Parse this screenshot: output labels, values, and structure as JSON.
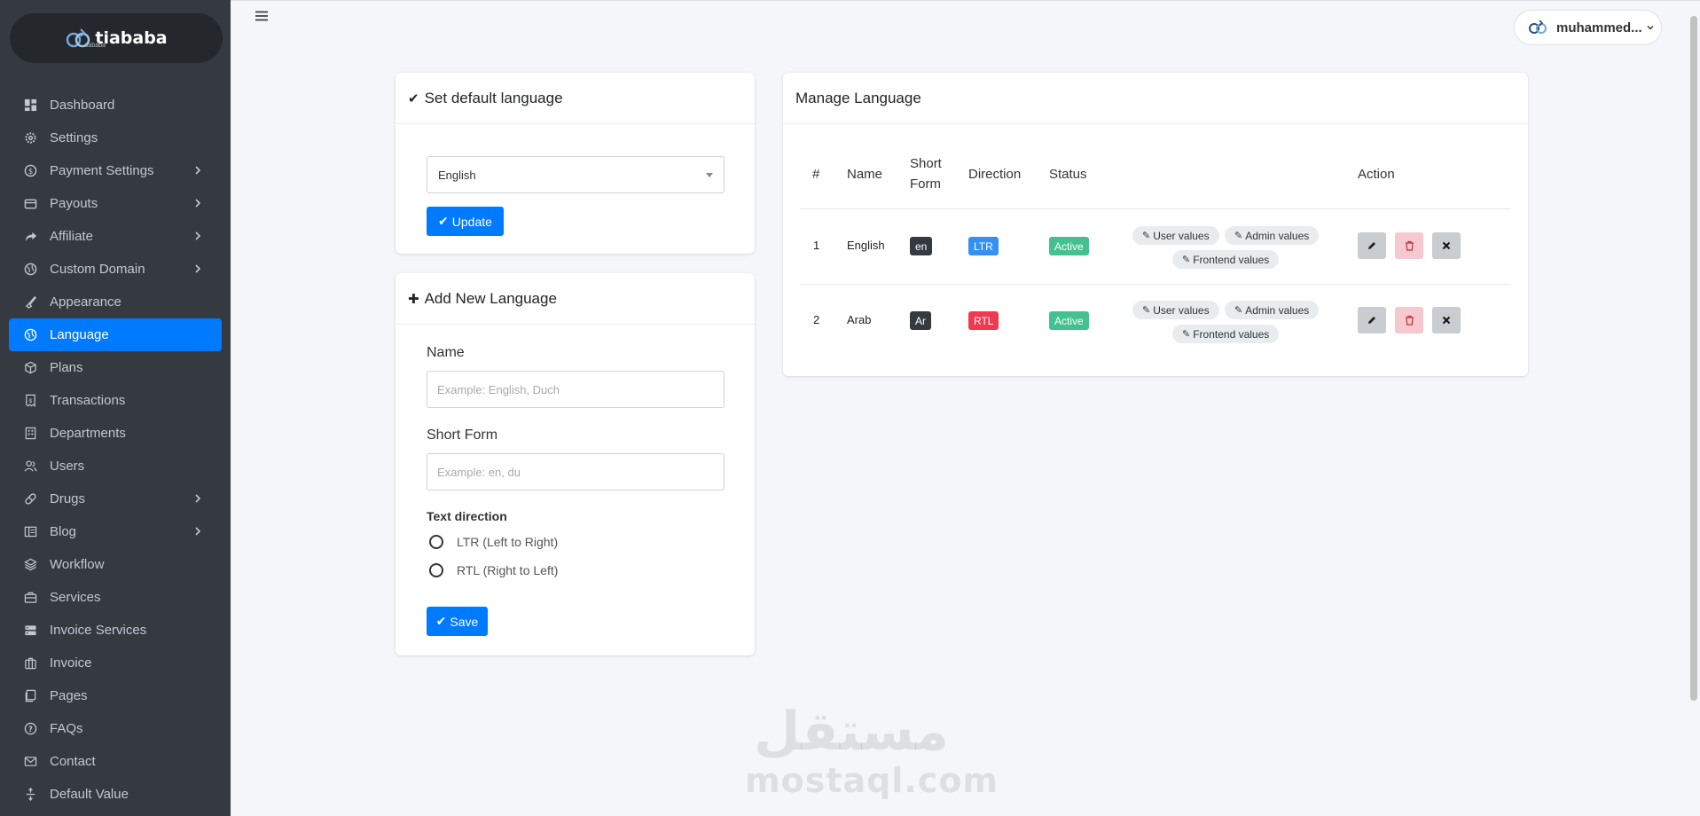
{
  "brand": {
    "name": "tiababa",
    "sub": "tiababa"
  },
  "sidebar": {
    "items": [
      {
        "label": "Dashboard",
        "icon": "dashboard-icon",
        "arrow": false
      },
      {
        "label": "Settings",
        "icon": "gear-icon",
        "arrow": false
      },
      {
        "label": "Payment Settings",
        "icon": "dollar-icon",
        "arrow": true
      },
      {
        "label": "Payouts",
        "icon": "wallet-icon",
        "arrow": true
      },
      {
        "label": "Affiliate",
        "icon": "share-icon",
        "arrow": true
      },
      {
        "label": "Custom Domain",
        "icon": "globe-icon",
        "arrow": true
      },
      {
        "label": "Appearance",
        "icon": "brush-icon",
        "arrow": false
      },
      {
        "label": "Language",
        "icon": "globe-icon",
        "arrow": false,
        "active": true
      },
      {
        "label": "Plans",
        "icon": "cube-icon",
        "arrow": false
      },
      {
        "label": "Transactions",
        "icon": "receipt-icon",
        "arrow": false
      },
      {
        "label": "Departments",
        "icon": "building-icon",
        "arrow": false
      },
      {
        "label": "Users",
        "icon": "users-icon",
        "arrow": false
      },
      {
        "label": "Drugs",
        "icon": "pill-icon",
        "arrow": true
      },
      {
        "label": "Blog",
        "icon": "blog-icon",
        "arrow": true
      },
      {
        "label": "Workflow",
        "icon": "layers-icon",
        "arrow": false
      },
      {
        "label": "Services",
        "icon": "briefcase-icon",
        "arrow": false
      },
      {
        "label": "Invoice Services",
        "icon": "server-icon",
        "arrow": false
      },
      {
        "label": "Invoice",
        "icon": "suitcase-icon",
        "arrow": false
      },
      {
        "label": "Pages",
        "icon": "pages-icon",
        "arrow": false
      },
      {
        "label": "FAQs",
        "icon": "question-icon",
        "arrow": false
      },
      {
        "label": "Contact",
        "icon": "envelope-icon",
        "arrow": false
      },
      {
        "label": "Default Value",
        "icon": "arrows-icon",
        "arrow": false
      }
    ]
  },
  "header": {
    "user_name": "muhammed..."
  },
  "default_language": {
    "title": "Set default language",
    "selected": "English",
    "update_label": "Update"
  },
  "add_language": {
    "title": "Add New Language",
    "name_label": "Name",
    "name_placeholder": "Example: English, Duch",
    "short_label": "Short Form",
    "short_placeholder": "Example: en, du",
    "direction_label": "Text direction",
    "ltr_label": "LTR (Left to Right)",
    "rtl_label": "RTL (Right to Left)",
    "save_label": "Save"
  },
  "manage": {
    "title": "Manage Language",
    "columns": {
      "num": "#",
      "name": "Name",
      "short1": "Short",
      "short2": "Form",
      "direction": "Direction",
      "status": "Status",
      "action": "Action"
    },
    "rows": [
      {
        "num": "1",
        "name": "English",
        "short": "en",
        "direction": "LTR",
        "status": "Active"
      },
      {
        "num": "2",
        "name": "Arab",
        "short": "Ar",
        "direction": "RTL",
        "status": "Active"
      }
    ],
    "pills": {
      "user": "User values",
      "admin": "Admin values",
      "frontend": "Frontend values"
    }
  },
  "watermark": {
    "ar": "مستقل",
    "en": "mostaql.com"
  },
  "colors": {
    "primary": "#007bff",
    "sidebar": "#343a40",
    "success": "#44c191",
    "danger": "#f0384f"
  }
}
